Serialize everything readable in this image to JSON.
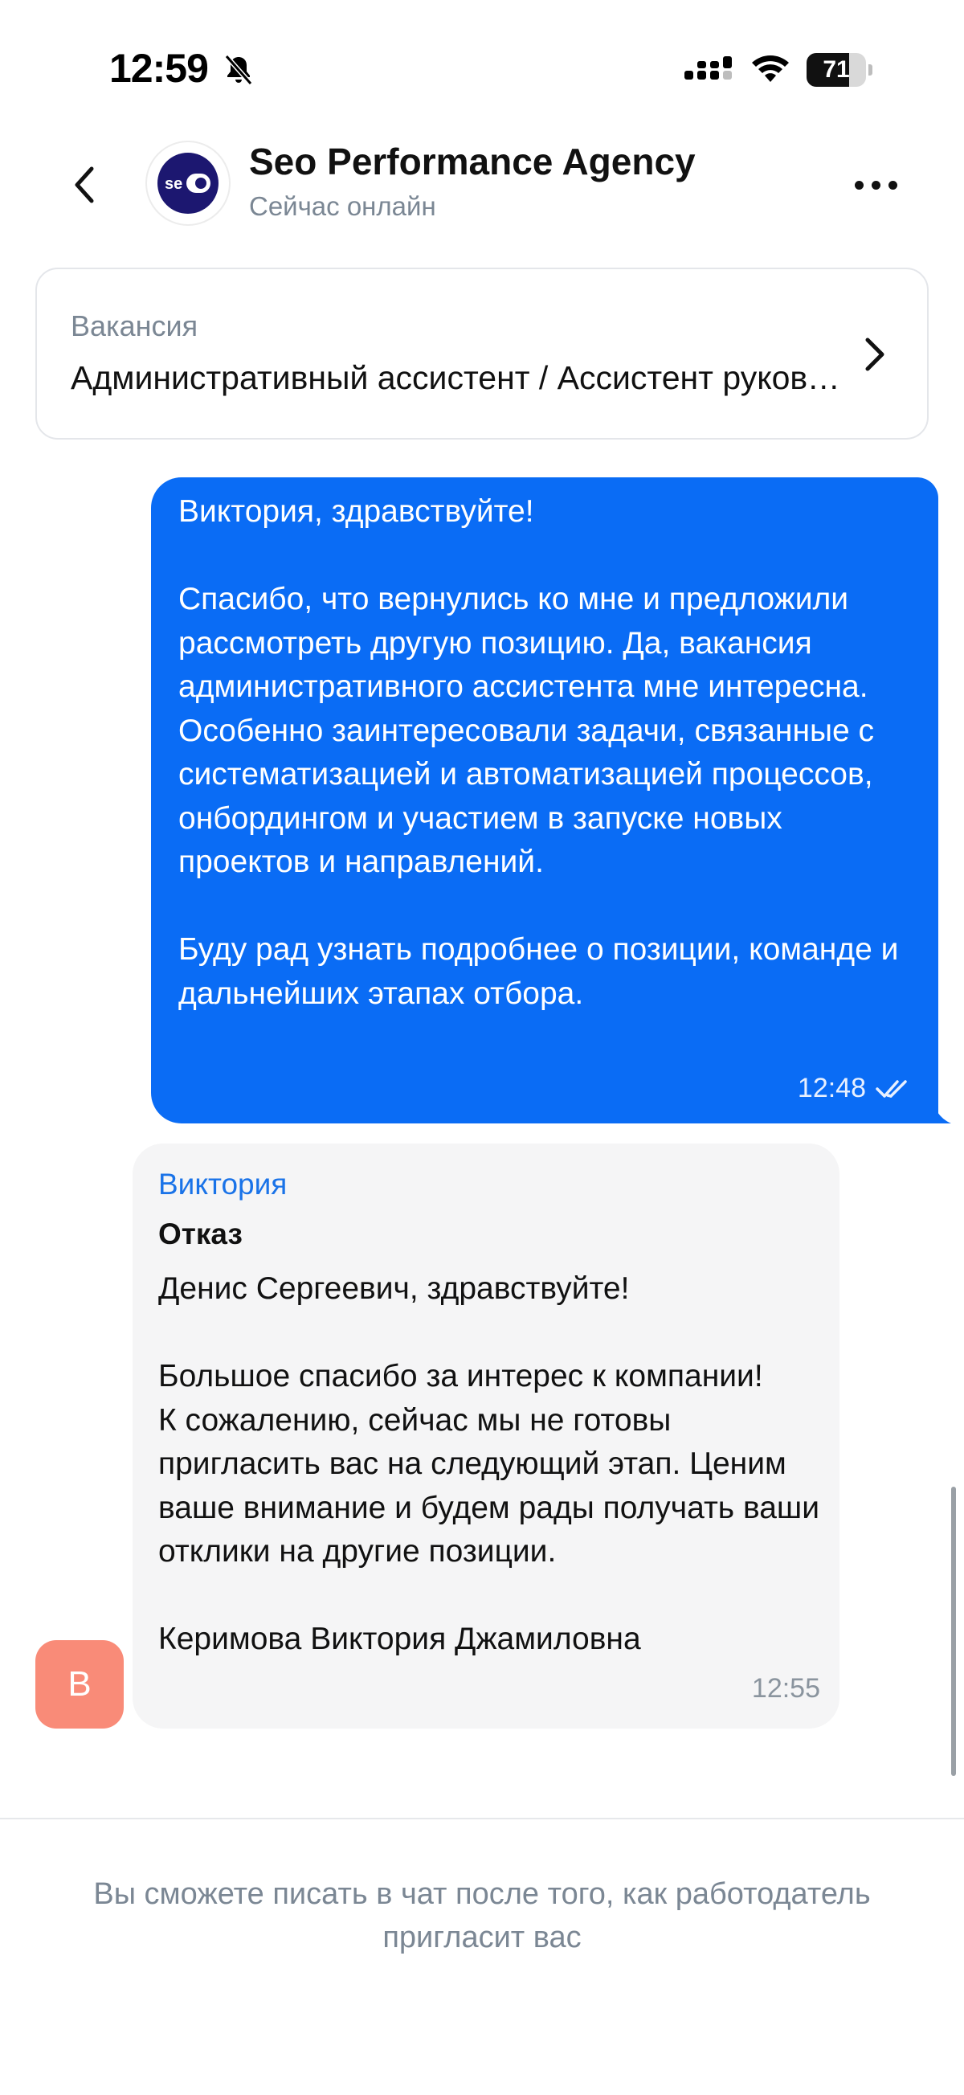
{
  "status_bar": {
    "time": "12:59",
    "battery_level": "71",
    "battery_fraction": 0.71,
    "icons": [
      "bell-muted-icon",
      "cellular-signal-icon",
      "wifi-icon",
      "battery-icon"
    ]
  },
  "header": {
    "back_icon": "chevron-left-icon",
    "avatar_text": "se",
    "company_name": "Seo Performance Agency",
    "status": "Сейчас онлайн",
    "more_icon": "more-horizontal-icon"
  },
  "vacancy": {
    "label": "Вакансия",
    "title": "Административный ассистент / Ассистент руководителя",
    "chevron_icon": "chevron-right-icon"
  },
  "messages": {
    "outgoing": {
      "text": "Виктория, здравствуйте!\n\nСпасибо, что вернулись ко мне и предложили рассмотреть другую позицию. Да, вакансия административного ассистента мне интересна. Особенно заинтересовали задачи, связанные с систематизацией и автоматизацией процессов, онбордингом и участием в запуске новых проектов и направлений.\n\nБуду рад узнать подробнее о позиции, команде и дальнейших этапах отбора.",
      "time": "12:48",
      "status_icon": "double-check-icon"
    },
    "incoming": {
      "sender": "Виктория",
      "subject": "Отказ",
      "text": "Денис Сергеевич, здравствуйте!\n\nБольшое спасибо за интерес к компании!\nК сожалению, сейчас мы не готовы пригласить вас на следующий этап. Ценим ваше внимание и будем рады получать ваши отклики на другие позиции.\n\nКеримова Виктория Джамиловна",
      "time": "12:55",
      "avatar_letter": "В",
      "avatar_color": "#f98b78"
    }
  },
  "footer": {
    "note": "Вы сможете писать в чат после того, как работодатель пригласит вас"
  },
  "colors": {
    "accent": "#0a6cf5",
    "sender_name": "#1a73e8",
    "muted_text": "#7b8794",
    "incoming_bubble": "#f5f5f6"
  }
}
